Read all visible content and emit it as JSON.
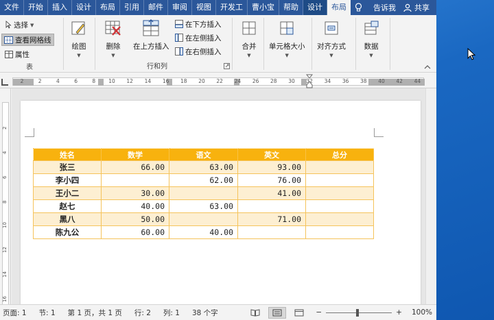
{
  "tabs": [
    {
      "label": "文件",
      "active": false
    },
    {
      "label": "开始",
      "active": false
    },
    {
      "label": "插入",
      "active": false
    },
    {
      "label": "设计",
      "active": false
    },
    {
      "label": "布局",
      "active": false
    },
    {
      "label": "引用",
      "active": false
    },
    {
      "label": "邮件",
      "active": false
    },
    {
      "label": "审阅",
      "active": false
    },
    {
      "label": "视图",
      "active": false
    },
    {
      "label": "开发工",
      "active": false
    },
    {
      "label": "曹小宝",
      "active": false
    },
    {
      "label": "帮助",
      "active": false
    },
    {
      "label": "设计",
      "active": false
    },
    {
      "label": "布局",
      "active": true
    }
  ],
  "tell_me": "告诉我",
  "share": "共享",
  "ribbon": {
    "table_group": {
      "select": "选择",
      "view_gridlines": "查看网格线",
      "properties": "属性",
      "label": "表"
    },
    "draw": "绘图",
    "delete": "删除",
    "insert_above": "在上方插入",
    "insert_below": "在下方插入",
    "insert_left": "在左侧插入",
    "insert_right": "在右侧插入",
    "rows_cols_label": "行和列",
    "merge": "合并",
    "cell_size": "单元格大小",
    "alignment": "对齐方式",
    "data": "数据"
  },
  "ruler_ticks": [
    "2",
    "2",
    "4",
    "6",
    "8",
    "10",
    "12",
    "14",
    "16",
    "18",
    "20",
    "22",
    "24",
    "26",
    "28",
    "30",
    "32",
    "34",
    "36",
    "38",
    "40",
    "42",
    "44"
  ],
  "vruler_ticks": [
    "2",
    "4",
    "6",
    "8",
    "10",
    "12",
    "14",
    "16"
  ],
  "table": {
    "headers": [
      "姓名",
      "数学",
      "语文",
      "英文",
      "总分"
    ],
    "rows": [
      [
        "张三",
        "66.00",
        "63.00",
        "93.00",
        ""
      ],
      [
        "李小四",
        "",
        "62.00",
        "76.00",
        ""
      ],
      [
        "王小二",
        "30.00",
        "",
        "41.00",
        ""
      ],
      [
        "赵七",
        "40.00",
        "63.00",
        "",
        ""
      ],
      [
        "黑八",
        "50.00",
        "",
        "71.00",
        ""
      ],
      [
        "陈九公",
        "60.00",
        "40.00",
        "",
        ""
      ]
    ]
  },
  "status": {
    "page": "页面: 1",
    "section": "节: 1",
    "pages": "第 1 页，共 1 页",
    "row": "行: 2",
    "col": "列: 1",
    "chars": "38 个字",
    "zoom": "100%",
    "zoom_minus": "−",
    "zoom_plus": "+"
  },
  "colors": {
    "title_bar": "#2b579a",
    "table_header": "#f8b20e",
    "table_alt_row": "#fdefd2",
    "desktop": "#1a68c2"
  }
}
